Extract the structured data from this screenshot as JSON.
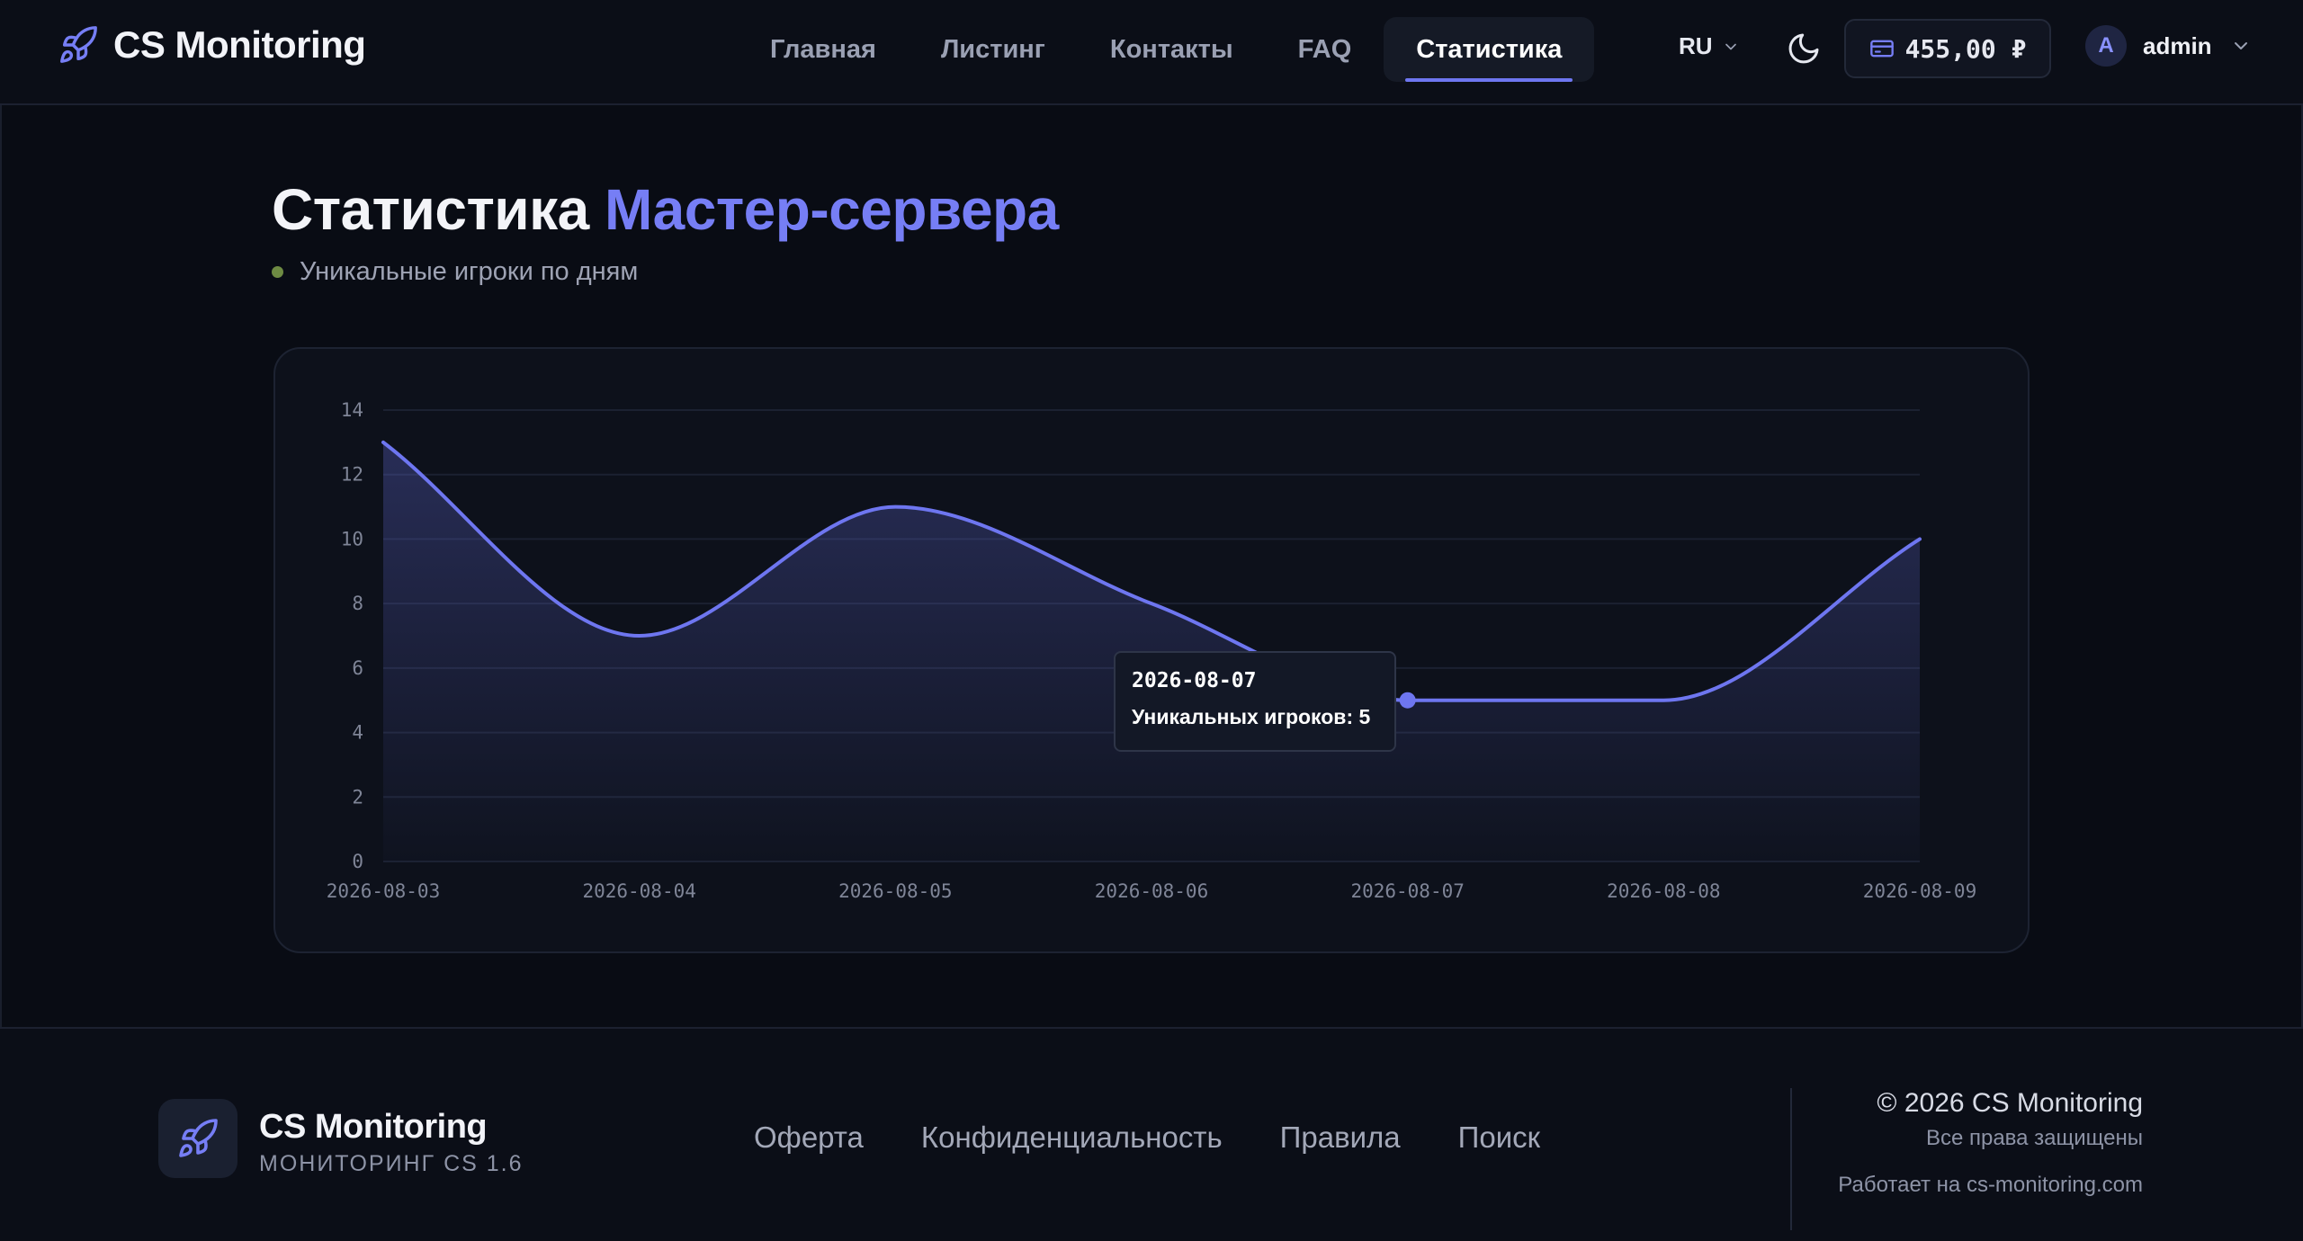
{
  "brand": {
    "name": "CS Monitoring"
  },
  "nav": {
    "items": [
      {
        "label": "Главная"
      },
      {
        "label": "Листинг"
      },
      {
        "label": "Контакты"
      },
      {
        "label": "FAQ"
      },
      {
        "label": "Статистика",
        "active": true
      }
    ]
  },
  "header": {
    "language": "RU",
    "balance": "455,00 ₽",
    "user": {
      "initial": "A",
      "name": "admin"
    }
  },
  "page": {
    "title_main": "Статистика",
    "title_accent": "Мастер-сервера",
    "subtitle": "Уникальные игроки по дням"
  },
  "chart_data": {
    "type": "area",
    "x": [
      "2026-08-03",
      "2026-08-04",
      "2026-08-05",
      "2026-08-06",
      "2026-08-07",
      "2026-08-08",
      "2026-08-09"
    ],
    "series": [
      {
        "values": [
          13,
          7,
          11,
          8,
          5,
          5,
          10
        ]
      }
    ],
    "ylim": [
      0,
      14
    ],
    "yticks": [
      0,
      2,
      4,
      6,
      8,
      10,
      12,
      14
    ],
    "grid": true,
    "line_color": "#6e76f0",
    "tooltip": {
      "date": "2026-08-07",
      "text": "Уникальных игроков: 5",
      "index": 4
    }
  },
  "footer": {
    "brand_name": "CS Monitoring",
    "brand_sub": "МОНИТОРИНГ CS 1.6",
    "links": [
      {
        "label": "Оферта"
      },
      {
        "label": "Конфиденциальность"
      },
      {
        "label": "Правила"
      },
      {
        "label": "Поиск"
      }
    ],
    "copyright": "© 2026 CS Monitoring",
    "rights": "Все права защищены",
    "powered": "Работает на cs-monitoring.com"
  },
  "colors": {
    "accent": "#767ef5",
    "status_dot": "#6e8b43",
    "background": "#090c14"
  },
  "icons": {
    "brand": "rocket-icon",
    "theme": "moon-icon",
    "balance": "wallet-icon",
    "dropdown": "chevron-down-icon"
  }
}
